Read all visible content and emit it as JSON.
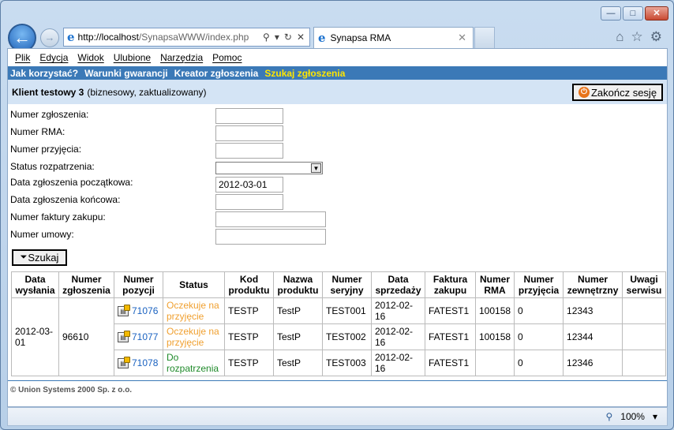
{
  "browser": {
    "url_host": "http://localhost",
    "url_rest": "/SynapsaWWW/index.php",
    "tab_title": "Synapsa RMA",
    "zoom": "100%"
  },
  "menu": [
    "Plik",
    "Edycja",
    "Widok",
    "Ulubione",
    "Narzędzia",
    "Pomoc"
  ],
  "nav": {
    "items": [
      "Jak korzystać?",
      "Warunki gwarancji",
      "Kreator zgłoszenia",
      "Szukaj zgłoszenia"
    ],
    "active_index": 3
  },
  "client": {
    "name": "Klient testowy 3",
    "details": "(biznesowy, zaktualizowany)",
    "end_session": "Zakończ sesję"
  },
  "form": {
    "fields": [
      {
        "label": "Numer zgłoszenia:",
        "value": ""
      },
      {
        "label": "Numer RMA:",
        "value": ""
      },
      {
        "label": "Numer przyjęcia:",
        "value": ""
      },
      {
        "label": "Status rozpatrzenia:",
        "value": ""
      },
      {
        "label": "Data zgłoszenia początkowa:",
        "value": "2012-03-01"
      },
      {
        "label": "Data zgłoszenia końcowa:",
        "value": ""
      },
      {
        "label": "Numer faktury zakupu:",
        "value": ""
      },
      {
        "label": "Numer umowy:",
        "value": ""
      }
    ],
    "search_label": "Szukaj"
  },
  "table": {
    "headers": [
      "Data wysłania",
      "Numer zgłoszenia",
      "Numer pozycji",
      "Status",
      "Kod produktu",
      "Nazwa produktu",
      "Numer seryjny",
      "Data sprzedaży",
      "Faktura zakupu",
      "Numer RMA",
      "Numer przyjęcia",
      "Numer zewnętrzny",
      "Uwagi serwisu"
    ],
    "group": {
      "date": "2012-03-01",
      "number": "96610"
    },
    "rows": [
      {
        "pos": "71076",
        "status": "Oczekuje na przyjęcie",
        "status_type": "waiting",
        "code": "TESTP",
        "name": "TestP",
        "serial": "TEST001",
        "sale_date": "2012-02-16",
        "invoice": "FATEST1",
        "rma": "100158",
        "receipt": "0",
        "external": "12343",
        "notes": ""
      },
      {
        "pos": "71077",
        "status": "Oczekuje na przyjęcie",
        "status_type": "waiting",
        "code": "TESTP",
        "name": "TestP",
        "serial": "TEST002",
        "sale_date": "2012-02-16",
        "invoice": "FATEST1",
        "rma": "100158",
        "receipt": "0",
        "external": "12344",
        "notes": ""
      },
      {
        "pos": "71078",
        "status": "Do rozpatrzenia",
        "status_type": "review",
        "code": "TESTP",
        "name": "TestP",
        "serial": "TEST003",
        "sale_date": "2012-02-16",
        "invoice": "FATEST1",
        "rma": "",
        "receipt": "0",
        "external": "12346",
        "notes": ""
      }
    ]
  },
  "footer": "© Union Systems 2000 Sp. z o.o.",
  "colors": {
    "nav_bg": "#3b79b7",
    "nav_active": "#ffe600",
    "client_bg": "#d4e4f5",
    "status_waiting": "#f0a030",
    "status_review": "#1f8a2a",
    "link": "#1a62c0"
  }
}
